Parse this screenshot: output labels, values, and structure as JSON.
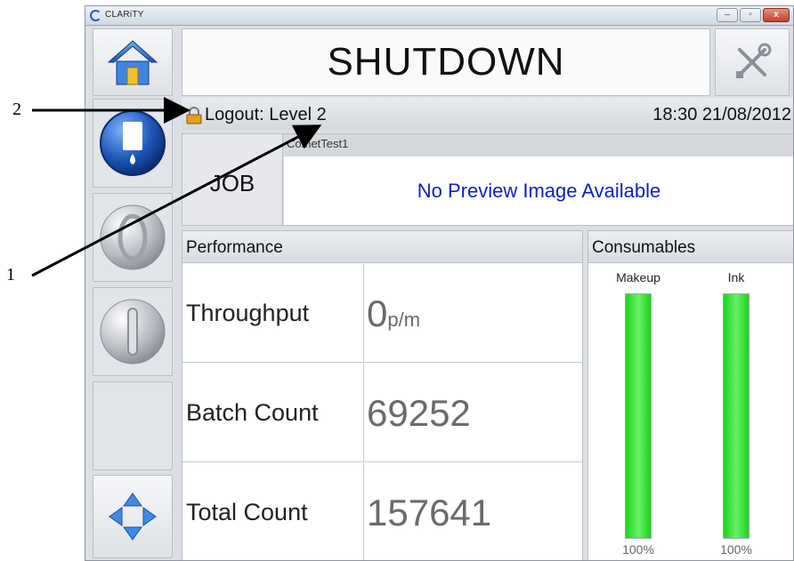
{
  "callouts": {
    "one": "1",
    "two": "2"
  },
  "window": {
    "title": "CLARiTY",
    "minimize": "–",
    "maximize": "▫",
    "close": "x"
  },
  "header": {
    "state": "SHUTDOWN"
  },
  "status": {
    "logout_label": "Logout: Level 2",
    "datetime": "18:30 21/08/2012"
  },
  "job": {
    "button_label": "JOB",
    "name": "CometTest1",
    "preview_text": "No Preview Image Available"
  },
  "performance": {
    "title": "Performance",
    "rows": [
      {
        "label": "Throughput",
        "value": "0",
        "unit": "p/m"
      },
      {
        "label": "Batch Count",
        "value": "69252",
        "unit": ""
      },
      {
        "label": "Total Count",
        "value": "157641",
        "unit": ""
      }
    ]
  },
  "consumables": {
    "title": "Consumables",
    "items": [
      {
        "name": "Makeup",
        "percent": "100%",
        "level": 1.0
      },
      {
        "name": "Ink",
        "percent": "100%",
        "level": 1.0
      }
    ]
  },
  "colors": {
    "accent_blue": "#1e56b8",
    "preview_text": "#1020c0",
    "level_green": "#1bd41b"
  },
  "icons": {
    "home": "home-icon",
    "tools": "tools-icon",
    "ink": "ink-icon",
    "start": "start-icon",
    "stop": "stop-icon",
    "navigate": "navigate-arrows-icon",
    "lock": "lock-icon"
  }
}
